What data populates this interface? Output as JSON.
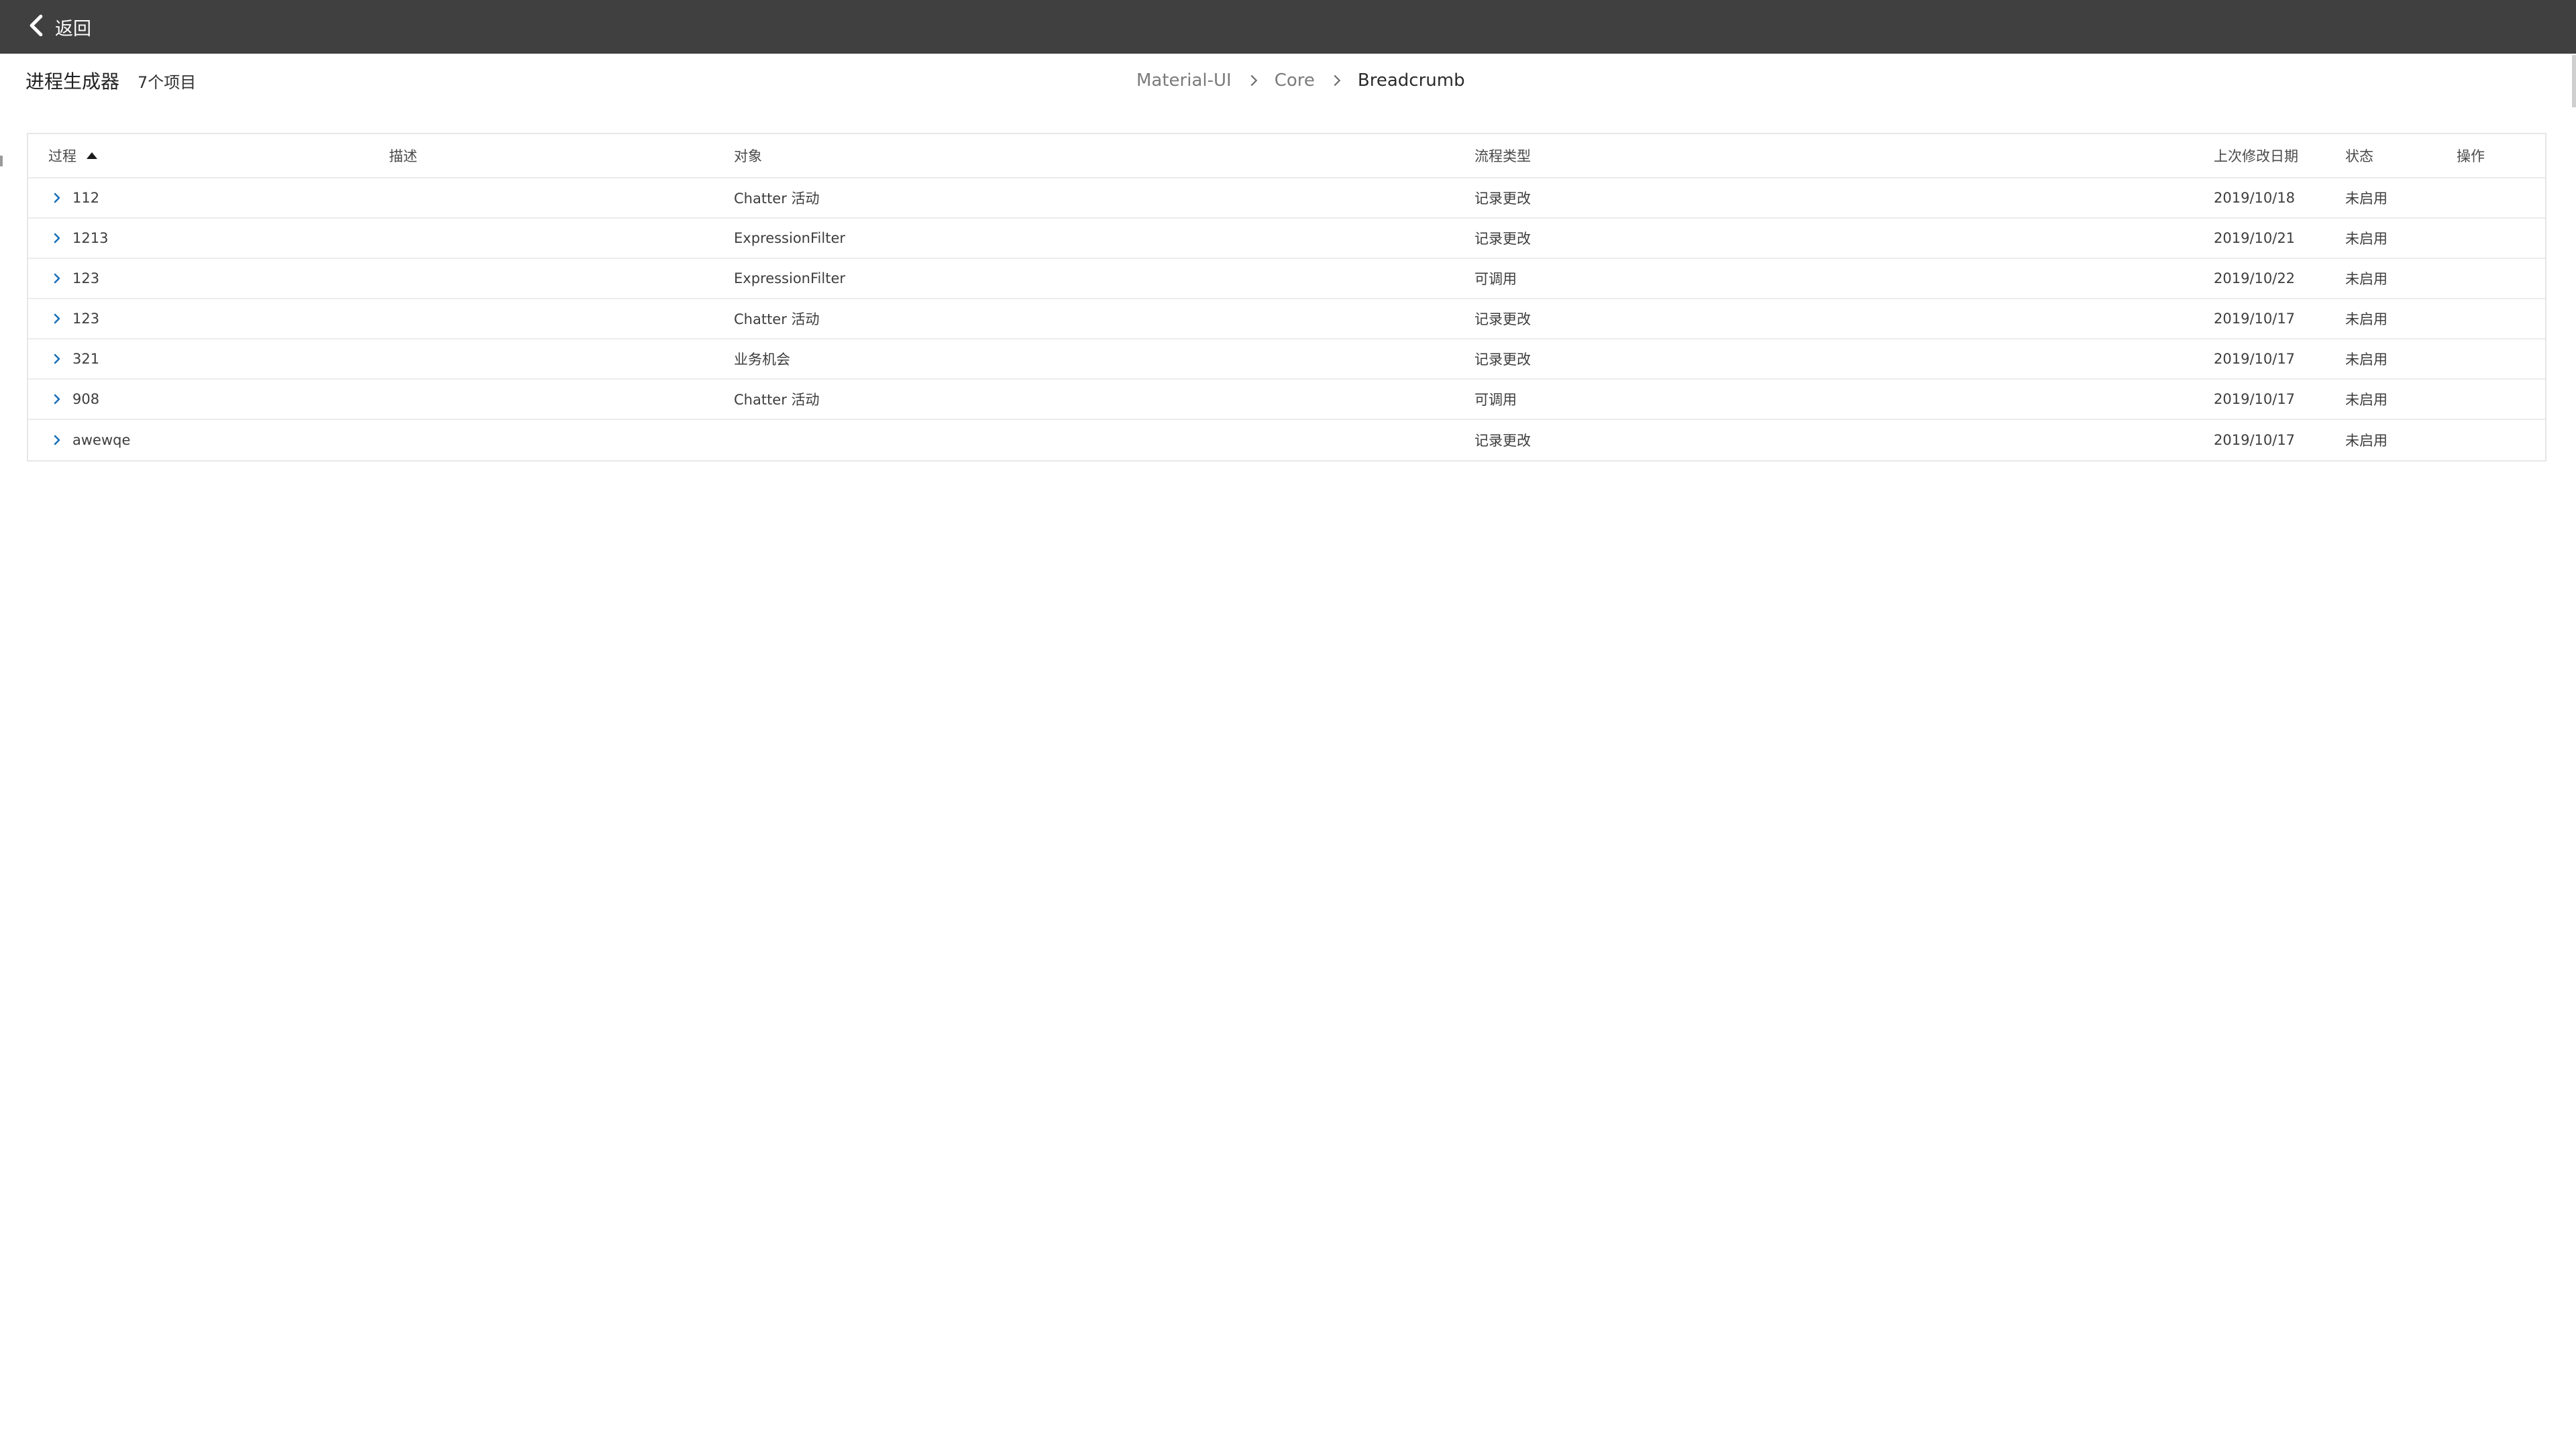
{
  "topbar": {
    "back_label": "返回"
  },
  "header": {
    "title": "进程生成器",
    "item_count": "7个项目",
    "breadcrumb": [
      "Material-UI",
      "Core",
      "Breadcrumb"
    ]
  },
  "table": {
    "columns": [
      "过程",
      "描述",
      "对象",
      "流程类型",
      "上次修改日期",
      "状态",
      "操作"
    ],
    "sorted_column": "过程",
    "sort_direction": "ascending",
    "rows": [
      {
        "process": "112",
        "description": "",
        "object": "Chatter 活动",
        "type": "记录更改",
        "modified": "2019/10/18",
        "status": "未启用",
        "action": ""
      },
      {
        "process": "1213",
        "description": "",
        "object": "ExpressionFilter",
        "type": "记录更改",
        "modified": "2019/10/21",
        "status": "未启用",
        "action": ""
      },
      {
        "process": "123",
        "description": "",
        "object": "ExpressionFilter",
        "type": "可调用",
        "modified": "2019/10/22",
        "status": "未启用",
        "action": ""
      },
      {
        "process": "123",
        "description": "",
        "object": "Chatter 活动",
        "type": "记录更改",
        "modified": "2019/10/17",
        "status": "未启用",
        "action": ""
      },
      {
        "process": "321",
        "description": "",
        "object": "业务机会",
        "type": "记录更改",
        "modified": "2019/10/17",
        "status": "未启用",
        "action": ""
      },
      {
        "process": "908",
        "description": "",
        "object": "Chatter 活动",
        "type": "可调用",
        "modified": "2019/10/17",
        "status": "未启用",
        "action": ""
      },
      {
        "process": "awewqe",
        "description": "",
        "object": "",
        "type": "记录更改",
        "modified": "2019/10/17",
        "status": "未启用",
        "action": ""
      }
    ]
  },
  "colors": {
    "topbar": "#404040",
    "expand_icon": "#1b6fb8",
    "border": "#e6e6e6"
  },
  "icons": {
    "back": "chevron-left-icon",
    "breadcrumb_separator": "chevron-right-icon",
    "sort": "caret-up-icon",
    "row_expand": "chevron-right-icon"
  }
}
